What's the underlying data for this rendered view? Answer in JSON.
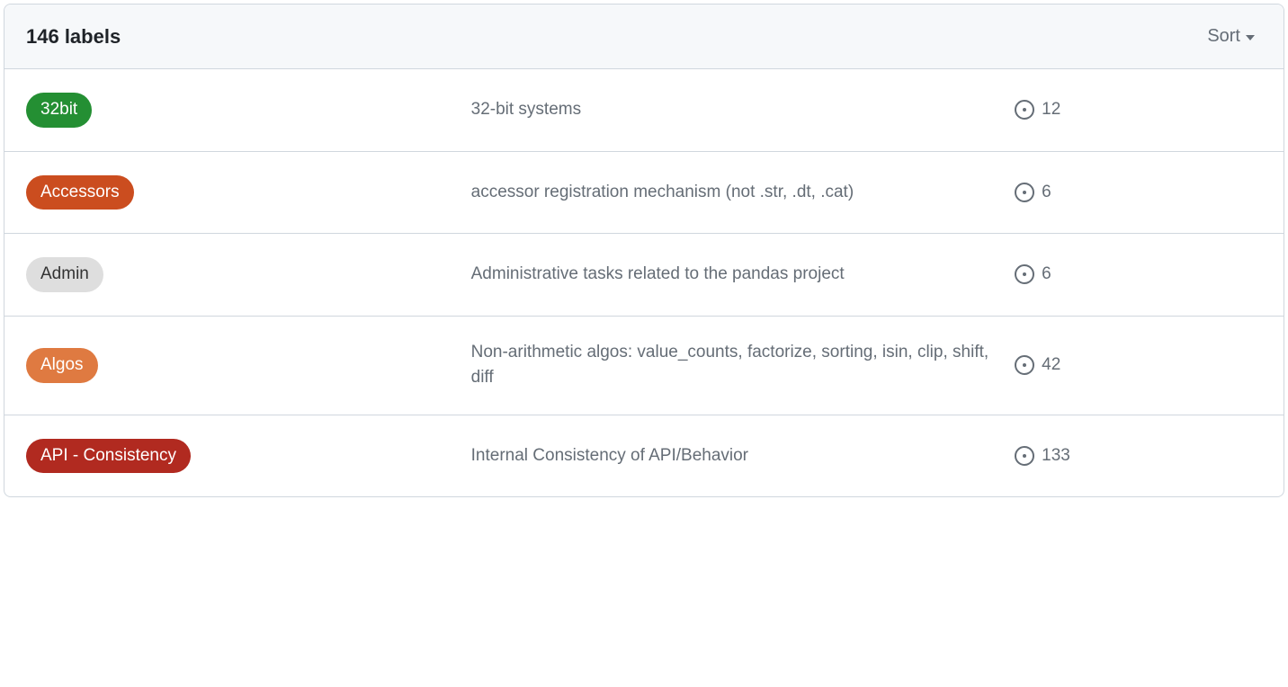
{
  "header": {
    "title": "146 labels",
    "sort_label": "Sort"
  },
  "labels": [
    {
      "name": "32bit",
      "bg": "#248f33",
      "fg": "#ffffff",
      "description": "32-bit systems",
      "count": 12
    },
    {
      "name": "Accessors",
      "bg": "#cb4d1f",
      "fg": "#ffffff",
      "description": "accessor registration mechanism (not .str, .dt, .cat)",
      "count": 6
    },
    {
      "name": "Admin",
      "bg": "#dedede",
      "fg": "#333333",
      "description": "Administrative tasks related to the pandas project",
      "count": 6
    },
    {
      "name": "Algos",
      "bg": "#df7a41",
      "fg": "#ffffff",
      "description": "Non-arithmetic algos: value_counts, factorize, sorting, isin, clip, shift, diff",
      "count": 42
    },
    {
      "name": "API - Consistency",
      "bg": "#b12a20",
      "fg": "#ffffff",
      "description": "Internal Consistency of API/Behavior",
      "count": 133
    }
  ]
}
